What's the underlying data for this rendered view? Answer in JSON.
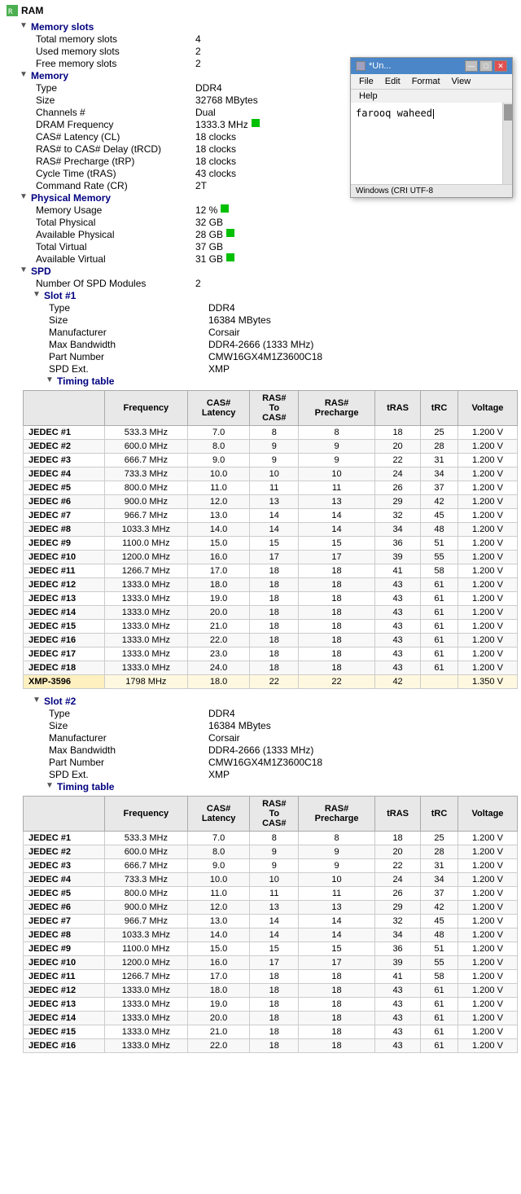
{
  "app": {
    "title": "RAM",
    "icon_color": "#4caf50"
  },
  "float_window": {
    "title": "*Un...",
    "menu_items": [
      "File",
      "Edit",
      "Format",
      "View",
      "Help"
    ],
    "content": "farooq waheed",
    "status_encoding": "UTF-8",
    "status_label": "Windows (CRI",
    "format_label": "Format"
  },
  "tree": {
    "memory_slots_label": "Memory slots",
    "total_memory_slots_label": "Total memory slots",
    "total_memory_slots_value": "4",
    "used_memory_slots_label": "Used memory slots",
    "used_memory_slots_value": "2",
    "free_memory_slots_label": "Free memory slots",
    "free_memory_slots_value": "2",
    "memory_label": "Memory",
    "type_label": "Type",
    "type_value": "DDR4",
    "size_label": "Size",
    "size_value": "32768 MBytes",
    "channels_label": "Channels #",
    "channels_value": "Dual",
    "dram_freq_label": "DRAM Frequency",
    "dram_freq_value": "1333.3 MHz",
    "cas_latency_label": "CAS# Latency (CL)",
    "cas_latency_value": "18 clocks",
    "ras_to_cas_label": "RAS# to CAS# Delay (tRCD)",
    "ras_to_cas_value": "18 clocks",
    "ras_precharge_label": "RAS# Precharge (tRP)",
    "ras_precharge_value": "18 clocks",
    "cycle_time_label": "Cycle Time (tRAS)",
    "cycle_time_value": "43 clocks",
    "command_rate_label": "Command Rate (CR)",
    "command_rate_value": "2T",
    "physical_memory_label": "Physical Memory",
    "memory_usage_label": "Memory Usage",
    "memory_usage_value": "12 %",
    "total_physical_label": "Total Physical",
    "total_physical_value": "32 GB",
    "available_physical_label": "Available Physical",
    "available_physical_value": "28 GB",
    "total_virtual_label": "Total Virtual",
    "total_virtual_value": "37 GB",
    "available_virtual_label": "Available Virtual",
    "available_virtual_value": "31 GB",
    "spd_label": "SPD",
    "num_spd_modules_label": "Number Of SPD Modules",
    "num_spd_modules_value": "2",
    "slot1_label": "Slot #1",
    "slot1_type_label": "Type",
    "slot1_type_value": "DDR4",
    "slot1_size_label": "Size",
    "slot1_size_value": "16384 MBytes",
    "slot1_mfr_label": "Manufacturer",
    "slot1_mfr_value": "Corsair",
    "slot1_maxbw_label": "Max Bandwidth",
    "slot1_maxbw_value": "DDR4-2666 (1333 MHz)",
    "slot1_pn_label": "Part Number",
    "slot1_pn_value": "CMW16GX4M1Z3600C18",
    "slot1_spdext_label": "SPD Ext.",
    "slot1_spdext_value": "XMP",
    "timing_table_label": "Timing table",
    "slot2_label": "Slot #2",
    "slot2_type_value": "DDR4",
    "slot2_size_value": "16384 MBytes",
    "slot2_mfr_value": "Corsair",
    "slot2_maxbw_value": "DDR4-2666 (1333 MHz)",
    "slot2_pn_value": "CMW16GX4M1Z3600C18",
    "slot2_spdext_value": "XMP"
  },
  "table_headers": [
    "Frequency",
    "CAS# Latency",
    "RAS# To CAS#",
    "RAS# Precharge",
    "tRAS",
    "tRC",
    "Voltage"
  ],
  "slot1_rows": [
    {
      "name": "JEDEC #1",
      "freq": "533.3 MHz",
      "cas": "7.0",
      "ras_cas": "8",
      "ras_pre": "8",
      "tras": "18",
      "trc": "25",
      "volt": "1.200 V"
    },
    {
      "name": "JEDEC #2",
      "freq": "600.0 MHz",
      "cas": "8.0",
      "ras_cas": "9",
      "ras_pre": "9",
      "tras": "20",
      "trc": "28",
      "volt": "1.200 V"
    },
    {
      "name": "JEDEC #3",
      "freq": "666.7 MHz",
      "cas": "9.0",
      "ras_cas": "9",
      "ras_pre": "9",
      "tras": "22",
      "trc": "31",
      "volt": "1.200 V"
    },
    {
      "name": "JEDEC #4",
      "freq": "733.3 MHz",
      "cas": "10.0",
      "ras_cas": "10",
      "ras_pre": "10",
      "tras": "24",
      "trc": "34",
      "volt": "1.200 V"
    },
    {
      "name": "JEDEC #5",
      "freq": "800.0 MHz",
      "cas": "11.0",
      "ras_cas": "11",
      "ras_pre": "11",
      "tras": "26",
      "trc": "37",
      "volt": "1.200 V"
    },
    {
      "name": "JEDEC #6",
      "freq": "900.0 MHz",
      "cas": "12.0",
      "ras_cas": "13",
      "ras_pre": "13",
      "tras": "29",
      "trc": "42",
      "volt": "1.200 V"
    },
    {
      "name": "JEDEC #7",
      "freq": "966.7 MHz",
      "cas": "13.0",
      "ras_cas": "14",
      "ras_pre": "14",
      "tras": "32",
      "trc": "45",
      "volt": "1.200 V"
    },
    {
      "name": "JEDEC #8",
      "freq": "1033.3 MHz",
      "cas": "14.0",
      "ras_cas": "14",
      "ras_pre": "14",
      "tras": "34",
      "trc": "48",
      "volt": "1.200 V"
    },
    {
      "name": "JEDEC #9",
      "freq": "1100.0 MHz",
      "cas": "15.0",
      "ras_cas": "15",
      "ras_pre": "15",
      "tras": "36",
      "trc": "51",
      "volt": "1.200 V"
    },
    {
      "name": "JEDEC #10",
      "freq": "1200.0 MHz",
      "cas": "16.0",
      "ras_cas": "17",
      "ras_pre": "17",
      "tras": "39",
      "trc": "55",
      "volt": "1.200 V"
    },
    {
      "name": "JEDEC #11",
      "freq": "1266.7 MHz",
      "cas": "17.0",
      "ras_cas": "18",
      "ras_pre": "18",
      "tras": "41",
      "trc": "58",
      "volt": "1.200 V"
    },
    {
      "name": "JEDEC #12",
      "freq": "1333.0 MHz",
      "cas": "18.0",
      "ras_cas": "18",
      "ras_pre": "18",
      "tras": "43",
      "trc": "61",
      "volt": "1.200 V"
    },
    {
      "name": "JEDEC #13",
      "freq": "1333.0 MHz",
      "cas": "19.0",
      "ras_cas": "18",
      "ras_pre": "18",
      "tras": "43",
      "trc": "61",
      "volt": "1.200 V"
    },
    {
      "name": "JEDEC #14",
      "freq": "1333.0 MHz",
      "cas": "20.0",
      "ras_cas": "18",
      "ras_pre": "18",
      "tras": "43",
      "trc": "61",
      "volt": "1.200 V"
    },
    {
      "name": "JEDEC #15",
      "freq": "1333.0 MHz",
      "cas": "21.0",
      "ras_cas": "18",
      "ras_pre": "18",
      "tras": "43",
      "trc": "61",
      "volt": "1.200 V"
    },
    {
      "name": "JEDEC #16",
      "freq": "1333.0 MHz",
      "cas": "22.0",
      "ras_cas": "18",
      "ras_pre": "18",
      "tras": "43",
      "trc": "61",
      "volt": "1.200 V"
    },
    {
      "name": "JEDEC #17",
      "freq": "1333.0 MHz",
      "cas": "23.0",
      "ras_cas": "18",
      "ras_pre": "18",
      "tras": "43",
      "trc": "61",
      "volt": "1.200 V"
    },
    {
      "name": "JEDEC #18",
      "freq": "1333.0 MHz",
      "cas": "24.0",
      "ras_cas": "18",
      "ras_pre": "18",
      "tras": "43",
      "trc": "61",
      "volt": "1.200 V"
    },
    {
      "name": "XMP-3596",
      "freq": "1798 MHz",
      "cas": "18.0",
      "ras_cas": "22",
      "ras_pre": "22",
      "tras": "42",
      "trc": "",
      "volt": "1.350 V",
      "xmp": true
    }
  ],
  "slot2_rows": [
    {
      "name": "JEDEC #1",
      "freq": "533.3 MHz",
      "cas": "7.0",
      "ras_cas": "8",
      "ras_pre": "8",
      "tras": "18",
      "trc": "25",
      "volt": "1.200 V"
    },
    {
      "name": "JEDEC #2",
      "freq": "600.0 MHz",
      "cas": "8.0",
      "ras_cas": "9",
      "ras_pre": "9",
      "tras": "20",
      "trc": "28",
      "volt": "1.200 V"
    },
    {
      "name": "JEDEC #3",
      "freq": "666.7 MHz",
      "cas": "9.0",
      "ras_cas": "9",
      "ras_pre": "9",
      "tras": "22",
      "trc": "31",
      "volt": "1.200 V"
    },
    {
      "name": "JEDEC #4",
      "freq": "733.3 MHz",
      "cas": "10.0",
      "ras_cas": "10",
      "ras_pre": "10",
      "tras": "24",
      "trc": "34",
      "volt": "1.200 V"
    },
    {
      "name": "JEDEC #5",
      "freq": "800.0 MHz",
      "cas": "11.0",
      "ras_cas": "11",
      "ras_pre": "11",
      "tras": "26",
      "trc": "37",
      "volt": "1.200 V"
    },
    {
      "name": "JEDEC #6",
      "freq": "900.0 MHz",
      "cas": "12.0",
      "ras_cas": "13",
      "ras_pre": "13",
      "tras": "29",
      "trc": "42",
      "volt": "1.200 V"
    },
    {
      "name": "JEDEC #7",
      "freq": "966.7 MHz",
      "cas": "13.0",
      "ras_cas": "14",
      "ras_pre": "14",
      "tras": "32",
      "trc": "45",
      "volt": "1.200 V"
    },
    {
      "name": "JEDEC #8",
      "freq": "1033.3 MHz",
      "cas": "14.0",
      "ras_cas": "14",
      "ras_pre": "14",
      "tras": "34",
      "trc": "48",
      "volt": "1.200 V"
    },
    {
      "name": "JEDEC #9",
      "freq": "1100.0 MHz",
      "cas": "15.0",
      "ras_cas": "15",
      "ras_pre": "15",
      "tras": "36",
      "trc": "51",
      "volt": "1.200 V"
    },
    {
      "name": "JEDEC #10",
      "freq": "1200.0 MHz",
      "cas": "16.0",
      "ras_cas": "17",
      "ras_pre": "17",
      "tras": "39",
      "trc": "55",
      "volt": "1.200 V"
    },
    {
      "name": "JEDEC #11",
      "freq": "1266.7 MHz",
      "cas": "17.0",
      "ras_cas": "18",
      "ras_pre": "18",
      "tras": "41",
      "trc": "58",
      "volt": "1.200 V"
    },
    {
      "name": "JEDEC #12",
      "freq": "1333.0 MHz",
      "cas": "18.0",
      "ras_cas": "18",
      "ras_pre": "18",
      "tras": "43",
      "trc": "61",
      "volt": "1.200 V"
    },
    {
      "name": "JEDEC #13",
      "freq": "1333.0 MHz",
      "cas": "19.0",
      "ras_cas": "18",
      "ras_pre": "18",
      "tras": "43",
      "trc": "61",
      "volt": "1.200 V"
    },
    {
      "name": "JEDEC #14",
      "freq": "1333.0 MHz",
      "cas": "20.0",
      "ras_cas": "18",
      "ras_pre": "18",
      "tras": "43",
      "trc": "61",
      "volt": "1.200 V"
    },
    {
      "name": "JEDEC #15",
      "freq": "1333.0 MHz",
      "cas": "21.0",
      "ras_cas": "18",
      "ras_pre": "18",
      "tras": "43",
      "trc": "61",
      "volt": "1.200 V"
    },
    {
      "name": "JEDEC #16",
      "freq": "1333.0 MHz",
      "cas": "22.0",
      "ras_cas": "18",
      "ras_pre": "18",
      "tras": "43",
      "trc": "61",
      "volt": "1.200 V"
    }
  ]
}
